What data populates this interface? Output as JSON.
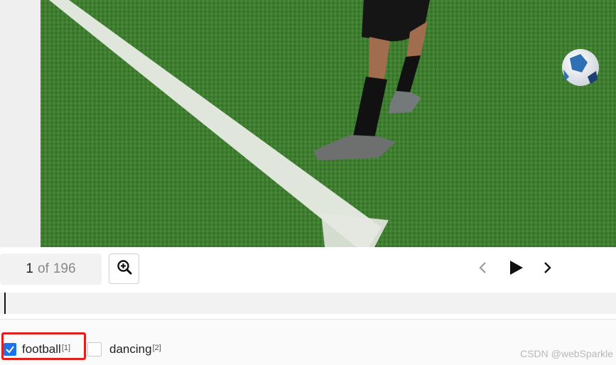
{
  "viewer": {
    "image_subject": "football player's legs near a white line with a football on green grass"
  },
  "controls": {
    "current_page": "1",
    "separator": "of",
    "total_pages": "196",
    "zoom_icon": "zoom-in-icon",
    "prev_icon": "chevron-left-icon",
    "play_icon": "play-icon",
    "next_icon": "chevron-right-icon"
  },
  "labels": [
    {
      "text": "football",
      "count": "[1]",
      "checked": true
    },
    {
      "text": "dancing",
      "count": "[2]",
      "checked": false
    }
  ],
  "watermark": "CSDN @webSparkle",
  "colors": {
    "checkbox_accent": "#1a73e8",
    "highlight": "#e0201b",
    "grass": "#3d7a2f"
  }
}
